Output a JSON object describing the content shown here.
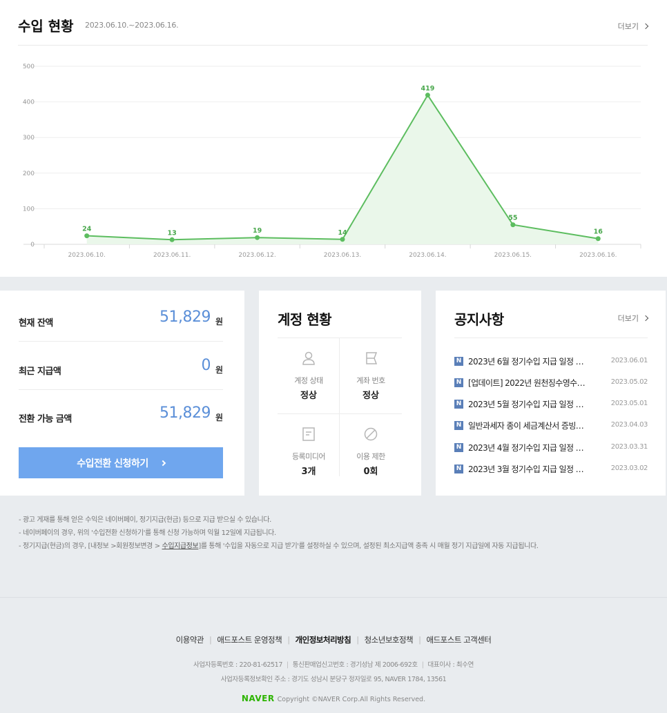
{
  "revenue": {
    "title": "수입 현황",
    "range": "2023.06.10.~2023.06.16.",
    "more_label": "더보기"
  },
  "chart_data": {
    "type": "area",
    "categories": [
      "2023.06.10.",
      "2023.06.11.",
      "2023.06.12.",
      "2023.06.13.",
      "2023.06.14.",
      "2023.06.15.",
      "2023.06.16."
    ],
    "values": [
      24,
      13,
      19,
      14,
      419,
      55,
      16
    ],
    "ylim": [
      0,
      500
    ],
    "yticks": [
      0,
      100,
      200,
      300,
      400,
      500
    ],
    "grid": true,
    "colors": {
      "line": "#5cbd5f",
      "fill": "#eaf7ea"
    }
  },
  "balance": {
    "rows": [
      {
        "label": "현재 잔액",
        "value": "51,829",
        "unit": "원"
      },
      {
        "label": "최근 지급액",
        "value": "0",
        "unit": "원"
      },
      {
        "label": "전환 가능 금액",
        "value": "51,829",
        "unit": "원"
      }
    ],
    "button_label": "수입전환 신청하기",
    "accent": "#6fa6ee"
  },
  "account": {
    "title": "계정 현황",
    "cells": [
      {
        "icon": "person-icon",
        "label": "계정 상태",
        "value": "정상"
      },
      {
        "icon": "card-icon",
        "label": "계좌 번호",
        "value": "정상"
      },
      {
        "icon": "document-icon",
        "label": "등록미디어",
        "value": "3개"
      },
      {
        "icon": "prohibited-icon",
        "label": "이용 제한",
        "value": "0회"
      }
    ]
  },
  "notice": {
    "title": "공지사항",
    "more_label": "더보기",
    "badge": "N",
    "items": [
      {
        "text": "2023년 6월 정기수입 지급 일정 …",
        "date": "2023.06.01"
      },
      {
        "text": "[업데이트] 2022년 원천징수영수…",
        "date": "2023.05.02"
      },
      {
        "text": "2023년 5월 정기수입 지급 일정 …",
        "date": "2023.05.01"
      },
      {
        "text": "일반과세자 종이 세금계산서 증빙…",
        "date": "2023.04.03"
      },
      {
        "text": "2023년 4월 정기수입 지급 일정 …",
        "date": "2023.03.31"
      },
      {
        "text": "2023년 3월 정기수입 지급 일정 …",
        "date": "2023.03.02"
      }
    ]
  },
  "notes": {
    "line1": "- 광고 게재를 통해 얻은 수익은 네이버페이, 정기지급(현금) 등으로 지급 받으실 수 있습니다.",
    "line2": "- 네이버페이의 경우, 위의 '수입전환 신청하기'를 통해 신청 가능하며 익월 12일에 지급됩니다.",
    "line3_pre": "- 정기지급(현금)의 경우, [내정보 >회원정보변경 > ",
    "line3_link": "수입지급정보",
    "line3_post": "]를 통해 '수입을 자동으로 지급 받기'를 설정하실 수 있으며, 설정된 최소지급액 충족 시 매월 정기 지급일에 자동 지급됩니다."
  },
  "footer": {
    "links": [
      "이용약관",
      "애드포스트 운영정책",
      "개인정보처리방침",
      "청소년보호정책",
      "애드포스트 고객센터"
    ],
    "biz_no": "사업자등록번호 : 220-81-62517",
    "mail_order": "통신판매업신고번호 : 경기성남 제 2006-692호",
    "ceo": "대표이사 : 최수연",
    "address": "사업자등록정보확인 주소 : 경기도 성남시 분당구 정자일로 95, NAVER 1784, 13561",
    "logo": "NAVER",
    "copyright": "Copyright ©NAVER Corp.All Rights Reserved."
  }
}
